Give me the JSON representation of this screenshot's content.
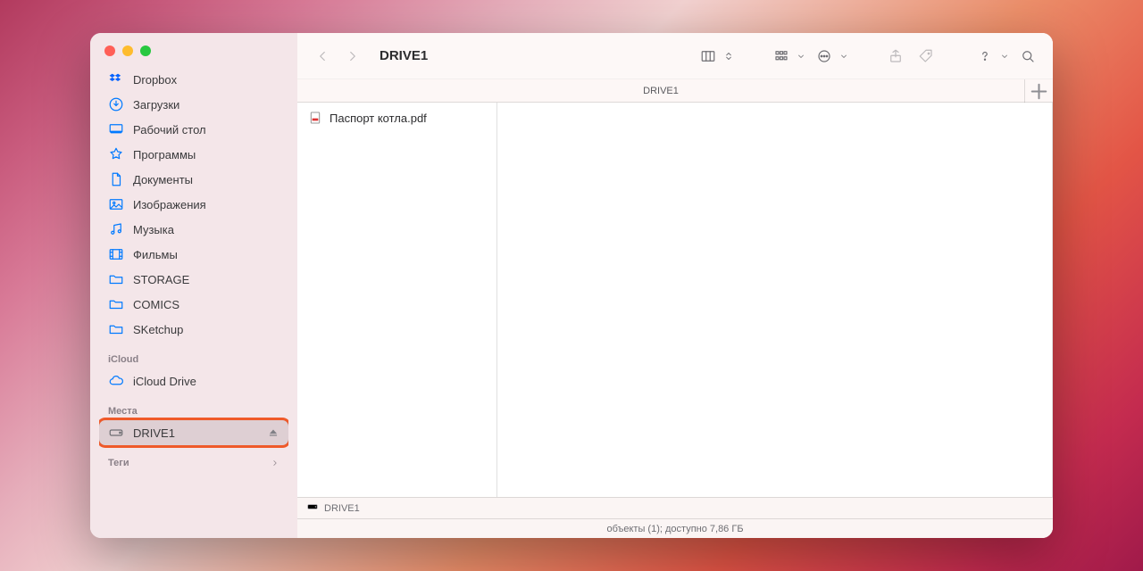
{
  "window": {
    "title": "DRIVE1"
  },
  "sidebar": {
    "favorites": [
      {
        "icon": "dropbox",
        "label": "Dropbox"
      },
      {
        "icon": "downloads",
        "label": "Загрузки"
      },
      {
        "icon": "desktop",
        "label": "Рабочий стол"
      },
      {
        "icon": "apps",
        "label": "Программы"
      },
      {
        "icon": "documents",
        "label": "Документы"
      },
      {
        "icon": "pictures",
        "label": "Изображения"
      },
      {
        "icon": "music",
        "label": "Музыка"
      },
      {
        "icon": "movies",
        "label": "Фильмы"
      },
      {
        "icon": "folder",
        "label": "STORAGE"
      },
      {
        "icon": "folder",
        "label": "COMICS"
      },
      {
        "icon": "folder",
        "label": "SKetchup"
      }
    ],
    "sections": {
      "icloud_header": "iCloud",
      "icloud_items": [
        {
          "icon": "cloud",
          "label": "iCloud Drive"
        }
      ],
      "locations_header": "Места",
      "locations_items": [
        {
          "icon": "drive",
          "label": "DRIVE1",
          "ejectable": true,
          "selected": true
        }
      ],
      "tags_header": "Теги"
    }
  },
  "header": {
    "column_title": "DRIVE1"
  },
  "files": [
    {
      "icon": "pdf",
      "name": "Паспорт котла.pdf"
    }
  ],
  "pathbar": {
    "device_icon": "drive",
    "label": "DRIVE1"
  },
  "statusbar": {
    "text": "объекты (1); доступно 7,86 ГБ"
  }
}
